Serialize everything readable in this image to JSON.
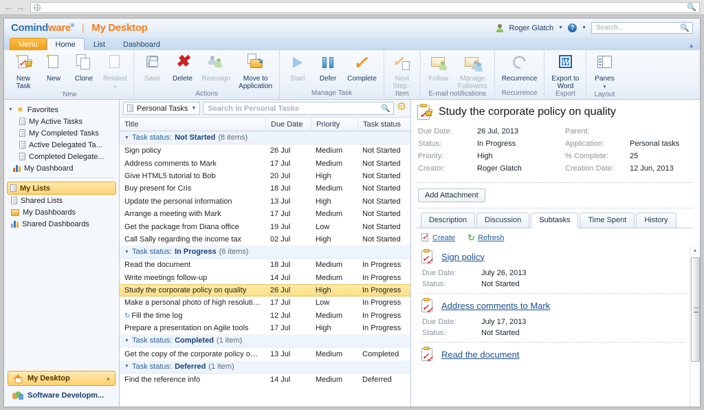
{
  "browser": {
    "back_icon": "back-arrow-icon",
    "forward_icon": "forward-arrow-icon",
    "url": ""
  },
  "brand": {
    "name_part1": "Comind",
    "name_part2": "ware",
    "registered": "®",
    "separator": "|",
    "page": "My Desktop"
  },
  "user": {
    "name": "Roger Glatch",
    "help_label": "?"
  },
  "search": {
    "placeholder": "Search...",
    "value": ""
  },
  "ribbon_tabs": [
    {
      "label": "Menu",
      "state": "menu"
    },
    {
      "label": "Home",
      "state": "active"
    },
    {
      "label": "List",
      "state": "normal"
    },
    {
      "label": "Dashboard",
      "state": "normal"
    }
  ],
  "ribbon": {
    "groups": [
      {
        "title": "New",
        "buttons": [
          {
            "label": "New\nTask",
            "label_l1": "New",
            "label_l2": "Task",
            "icon": "new-task-icon",
            "disabled": false
          },
          {
            "label": "New",
            "label_l1": "New",
            "label_l2": "",
            "icon": "new-icon",
            "disabled": false
          },
          {
            "label": "Clone",
            "label_l1": "Clone",
            "label_l2": "",
            "icon": "clone-icon",
            "disabled": false
          },
          {
            "label": "Related",
            "label_l1": "Related",
            "label_l2": "▾",
            "icon": "related-icon",
            "disabled": true
          }
        ]
      },
      {
        "title": "Actions",
        "buttons": [
          {
            "label_l1": "Save",
            "label_l2": "",
            "icon": "save-floppy-icon",
            "disabled": true
          },
          {
            "label_l1": "Delete",
            "label_l2": "",
            "icon": "delete-x-icon",
            "disabled": false
          },
          {
            "label_l1": "Reassign",
            "label_l2": "",
            "icon": "reassign-people-icon",
            "disabled": true
          },
          {
            "label_l1": "Move to",
            "label_l2": "Application",
            "icon": "move-to-application-icon",
            "disabled": false
          }
        ]
      },
      {
        "title": "Manage Task",
        "buttons": [
          {
            "label_l1": "Start",
            "label_l2": "",
            "icon": "start-play-icon",
            "disabled": true
          },
          {
            "label_l1": "Defer",
            "label_l2": "",
            "icon": "defer-pause-icon",
            "disabled": false
          },
          {
            "label_l1": "Complete",
            "label_l2": "",
            "icon": "complete-check-icon",
            "disabled": false
          }
        ]
      },
      {
        "title": "Item",
        "buttons": [
          {
            "label_l1": "Next",
            "label_l2": "Step ·",
            "icon": "next-step-icon",
            "disabled": true
          }
        ]
      },
      {
        "title": "E-mail notifications",
        "buttons": [
          {
            "label_l1": "Follow",
            "label_l2": "",
            "icon": "follow-envelope-icon",
            "disabled": true
          },
          {
            "label_l1": "Manage",
            "label_l2": "Followers",
            "icon": "manage-followers-icon",
            "disabled": true
          }
        ]
      },
      {
        "title": "Recurrence",
        "buttons": [
          {
            "label_l1": "Recurrence",
            "label_l2": "",
            "icon": "recurrence-icon",
            "disabled": false
          }
        ]
      },
      {
        "title": "Export",
        "buttons": [
          {
            "label_l1": "Export to",
            "label_l2": "Word",
            "icon": "export-to-word-icon",
            "disabled": false
          }
        ]
      },
      {
        "title": "Layout",
        "buttons": [
          {
            "label_l1": "Panes",
            "label_l2": "▾",
            "icon": "panes-icon",
            "disabled": false
          }
        ]
      }
    ]
  },
  "sidebar": {
    "tree": [
      {
        "label": "Favorites",
        "icon": "star-icon",
        "level": 0,
        "twisty": "◢",
        "selected": false
      },
      {
        "label": "My Active Tasks",
        "icon": "list-icon",
        "level": 1,
        "selected": false
      },
      {
        "label": "My Completed Tasks",
        "icon": "list-icon",
        "level": 1,
        "selected": false
      },
      {
        "label": "Active Delegated Ta...",
        "icon": "list-icon",
        "level": 1,
        "selected": false
      },
      {
        "label": "Completed Delegate...",
        "icon": "list-icon",
        "level": 1,
        "selected": false
      },
      {
        "label": "My Dashboard",
        "icon": "chart-icon",
        "level": 0,
        "selected": false
      }
    ],
    "tree2": [
      {
        "label": "My Lists",
        "icon": "my-lists-icon",
        "selected": true
      },
      {
        "label": "Shared Lists",
        "icon": "shared-lists-icon",
        "selected": false
      },
      {
        "label": "My Dashboards",
        "icon": "my-dashboards-icon",
        "selected": false
      },
      {
        "label": "Shared Dashboards",
        "icon": "shared-dashboards-icon",
        "selected": false
      }
    ],
    "bottom": [
      {
        "label": "My Desktop",
        "icon": "home-icon",
        "active": true,
        "expander": "▸"
      },
      {
        "label": "Software Developm...",
        "icon": "group-icon",
        "active": false
      }
    ]
  },
  "list_pane": {
    "selector_label": "Personal Tasks",
    "selector_icon": "list-icon",
    "search_placeholder": "Search in Personal Tasks",
    "search_value": "",
    "settings_icon": "gear-icon",
    "columns": [
      "Title",
      "Due Date",
      "Priority",
      "Task status"
    ],
    "groups": [
      {
        "label_prefix": "Task status:",
        "status": "Not Started",
        "count": "(8 items)",
        "rows": [
          {
            "title": "Sign policy",
            "due": "26 Jul",
            "priority": "Medium",
            "status": "Not Started",
            "selected": false,
            "recurring": false
          },
          {
            "title": "Address comments to Mark",
            "due": "17 Jul",
            "priority": "Medium",
            "status": "Not Started",
            "selected": false,
            "recurring": false
          },
          {
            "title": "Give HTML5 tutorial to Bob",
            "due": "20 Jul",
            "priority": "High",
            "status": "Not Started",
            "selected": false,
            "recurring": false
          },
          {
            "title": "Buy present for Cris",
            "due": "18 Jul",
            "priority": "Medium",
            "status": "Not Started",
            "selected": false,
            "recurring": false
          },
          {
            "title": "Update the personal information",
            "due": "13 Jul",
            "priority": "High",
            "status": "Not Started",
            "selected": false,
            "recurring": false
          },
          {
            "title": "Arrange a meeting with Mark",
            "due": "17 Jul",
            "priority": "Medium",
            "status": "Not Started",
            "selected": false,
            "recurring": false
          },
          {
            "title": "Get the package from Diana office",
            "due": "19 Jul",
            "priority": "Low",
            "status": "Not Started",
            "selected": false,
            "recurring": false
          },
          {
            "title": "Call Sally regarding the income tax",
            "due": "02 Jul",
            "priority": "High",
            "status": "Not Started",
            "selected": false,
            "recurring": false
          }
        ]
      },
      {
        "label_prefix": "Task status:",
        "status": "In Progress",
        "count": "(6 items)",
        "rows": [
          {
            "title": "Read the document",
            "due": "18 Jul",
            "priority": "Medium",
            "status": "In Progress",
            "selected": false,
            "recurring": false
          },
          {
            "title": "Write meetings follow-up",
            "due": "14 Jul",
            "priority": "Medium",
            "status": "In Progress",
            "selected": false,
            "recurring": false
          },
          {
            "title": "Study the corporate policy on quality",
            "due": "26 Jul",
            "priority": "High",
            "status": "In Progress",
            "selected": true,
            "recurring": false
          },
          {
            "title": "Make a personal photo of high resolution",
            "due": "17 Jul",
            "priority": "Low",
            "status": "In Progress",
            "selected": false,
            "recurring": false
          },
          {
            "title": "Fill the time log",
            "due": "12 Jul",
            "priority": "Medium",
            "status": "In Progress",
            "selected": false,
            "recurring": true
          },
          {
            "title": "Prepare a presentation on Agile tools",
            "due": "17 Jul",
            "priority": "High",
            "status": "In Progress",
            "selected": false,
            "recurring": false
          }
        ]
      },
      {
        "label_prefix": "Task status:",
        "status": "Completed",
        "count": "(1 item)",
        "rows": [
          {
            "title": "Get the copy of the corporate policy on quali...",
            "due": "13 Jul",
            "priority": "Medium",
            "status": "Completed",
            "selected": false,
            "recurring": false
          }
        ]
      },
      {
        "label_prefix": "Task status:",
        "status": "Deferred",
        "count": "(1 item)",
        "rows": [
          {
            "title": "Find the reference info",
            "due": "14 Jul",
            "priority": "Medium",
            "status": "Deferred",
            "selected": false,
            "recurring": false
          }
        ]
      }
    ]
  },
  "detail": {
    "title": "Study the corporate policy on quality",
    "title_icon": "task-locked-icon",
    "fields": [
      {
        "label": "Due Date:",
        "value": "26 Jul, 2013"
      },
      {
        "label": "Parent:",
        "value": ""
      },
      {
        "label": "Status:",
        "value": "In Progress"
      },
      {
        "label": "Application:",
        "value": "Personal tasks"
      },
      {
        "label": "Priority:",
        "value": "High"
      },
      {
        "label": "% Complete:",
        "value": "25"
      },
      {
        "label": "Creator:",
        "value": "Roger Glatch"
      },
      {
        "label": "Creation Date:",
        "value": "12 Jun, 2013"
      }
    ],
    "add_attachment_label": "Add Attachment",
    "tabs": [
      {
        "label": "Description",
        "active": false
      },
      {
        "label": "Discussion",
        "active": false
      },
      {
        "label": "Subtasks",
        "active": true
      },
      {
        "label": "Time Spent",
        "active": false
      },
      {
        "label": "History",
        "active": false
      }
    ],
    "subtask_actions": [
      {
        "label": "Create",
        "icon": "create-task-icon"
      },
      {
        "label": "Refresh",
        "icon": "refresh-icon"
      }
    ],
    "subtasks": [
      {
        "title": "Sign policy",
        "icon": "subtask-icon",
        "fields": [
          {
            "label": "Due Date:",
            "value": "July 26, 2013"
          },
          {
            "label": "Status:",
            "value": "Not Started"
          }
        ]
      },
      {
        "title": "Address comments to Mark",
        "icon": "subtask-icon",
        "fields": [
          {
            "label": "Due Date:",
            "value": "July 17, 2013"
          },
          {
            "label": "Status:",
            "value": "Not Started"
          }
        ]
      },
      {
        "title": "Read the document",
        "icon": "subtask-icon",
        "fields": []
      }
    ],
    "scrollbar": {
      "up_arrow": "▴",
      "down_arrow": "▾"
    }
  },
  "colors": {
    "brand_blue": "#2f6fb5",
    "brand_orange": "#ef7f1a",
    "selection_yellow": "#fbdf84",
    "link_blue": "#1b5fa8",
    "group_header_blue": "#2a6099"
  }
}
